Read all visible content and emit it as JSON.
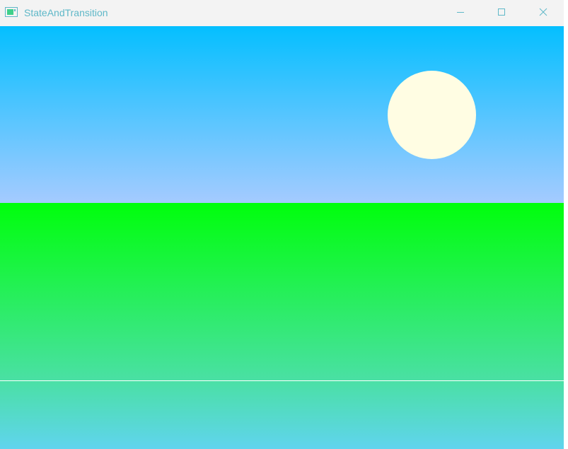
{
  "window": {
    "title": "StateAndTransition"
  },
  "icons": {
    "app": "app-window-icon",
    "minimize": "minimize-icon",
    "maximize": "maximize-icon",
    "close": "close-icon"
  },
  "colors": {
    "title_text": "#5fb8c8",
    "sky_top": "#04bfff",
    "sky_bottom": "#a5cbff",
    "sun": "#fffde3",
    "ground_top": "#00ff0c",
    "ground_mid": "#4ae0a4",
    "ground_bottom": "#60d4ee",
    "horizon_line": "#ffffff"
  }
}
